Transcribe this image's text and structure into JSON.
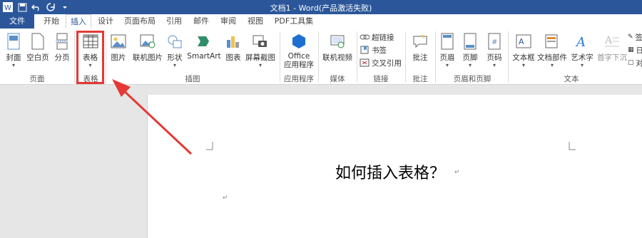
{
  "window": {
    "title": "文档1 - Word(产品激活失败)"
  },
  "qat": {
    "items": [
      "word-logo",
      "save",
      "undo",
      "redo",
      "customize"
    ]
  },
  "tabs": [
    "文件",
    "开始",
    "插入",
    "设计",
    "页面布局",
    "引用",
    "邮件",
    "审阅",
    "视图",
    "PDF工具集"
  ],
  "active_tab": "插入",
  "ribbon": {
    "groups": [
      {
        "name": "页面",
        "buttons": [
          "封面",
          "空白页",
          "分页"
        ]
      },
      {
        "name": "表格",
        "buttons": [
          "表格"
        ]
      },
      {
        "name": "插图",
        "buttons": [
          "图片",
          "联机图片",
          "形状",
          "SmartArt",
          "图表",
          "屏幕截图"
        ]
      },
      {
        "name": "应用程序",
        "buttons": [
          "Office\n应用程序"
        ]
      },
      {
        "name": "媒体",
        "buttons": [
          "联机视频"
        ]
      },
      {
        "name": "链接",
        "buttons": [
          "超链接",
          "书签",
          "交叉引用"
        ]
      },
      {
        "name": "批注",
        "buttons": [
          "批注"
        ]
      },
      {
        "name": "页眉和页脚",
        "buttons": [
          "页眉",
          "页脚",
          "页码"
        ]
      },
      {
        "name": "文本",
        "buttons": [
          "文本框",
          "文档部件",
          "艺术字",
          "首字下沉"
        ]
      }
    ],
    "office_line1": "Office",
    "office_line2": "应用程序",
    "right_partial": [
      "签",
      "日",
      "对"
    ]
  },
  "document": {
    "heading": "如何插入表格？"
  },
  "colors": {
    "titlebar": "#2b579a",
    "highlight": "#e53935"
  }
}
